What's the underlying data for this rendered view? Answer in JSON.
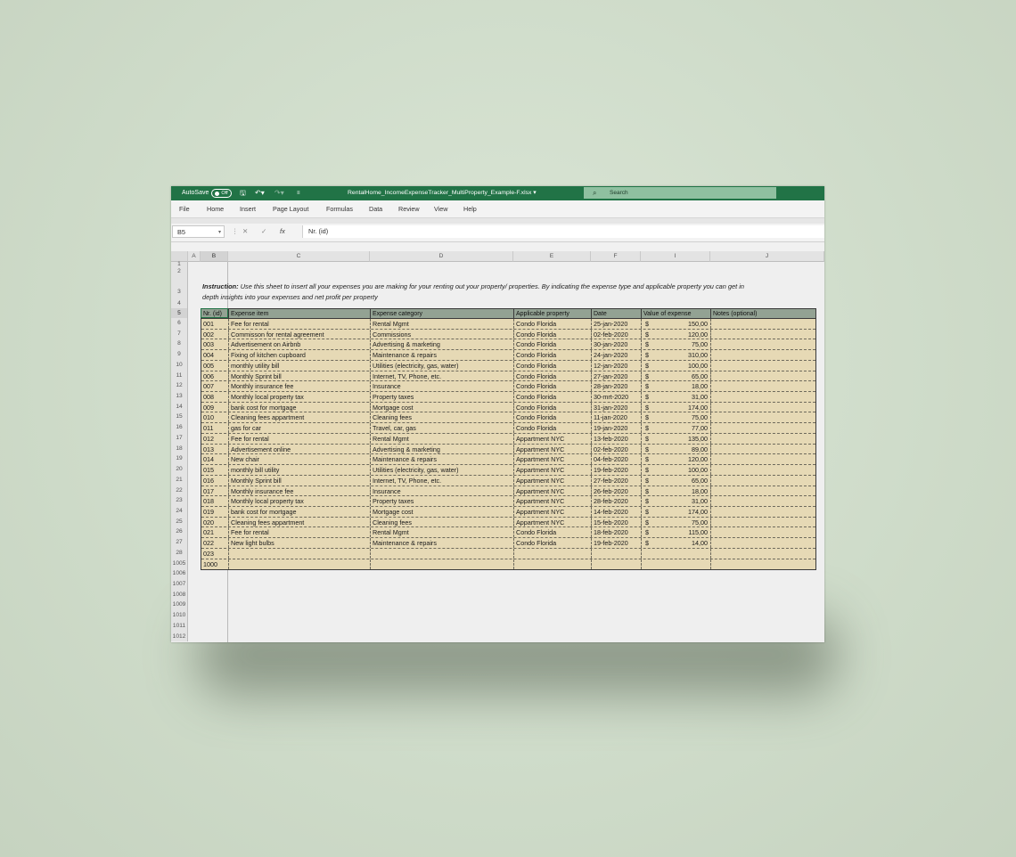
{
  "titlebar": {
    "autosave_label": "AutoSave",
    "autosave_state": "Off",
    "filename": "RentalHome_IncomeExpenseTracker_MultiProperty_Example-F.xlsx",
    "search_placeholder": "Search"
  },
  "menu": [
    "File",
    "Home",
    "Insert",
    "Page Layout",
    "Formulas",
    "Data",
    "Review",
    "View",
    "Help"
  ],
  "formula_bar": {
    "name_box": "B5",
    "fx": "fx",
    "content": "Nr. (id)"
  },
  "columns": [
    "A",
    "B",
    "C",
    "D",
    "E",
    "F",
    "I",
    "J"
  ],
  "row_numbers": [
    "1",
    "2",
    "3",
    "4",
    "5",
    "6",
    "7",
    "8",
    "9",
    "10",
    "11",
    "12",
    "13",
    "14",
    "15",
    "16",
    "17",
    "18",
    "19",
    "20",
    "21",
    "22",
    "23",
    "24",
    "25",
    "26",
    "27",
    "28",
    "1005",
    "1006",
    "1007",
    "1008",
    "1009",
    "1010",
    "1011",
    "1012"
  ],
  "instruction": {
    "label": "Instruction:",
    "line1": " Use this sheet to insert all your expenses you are making for your renting out your property/ properties. By indicating the expense type and applicable property you can get in",
    "line2": "depth insights into your expenses and net profit per property"
  },
  "table": {
    "headers": [
      "Nr. (id)",
      "Expense item",
      "Expense category",
      "Applicable property",
      "Date",
      "Value of expense",
      "Notes (optional)"
    ],
    "currency_symbol": "$",
    "rows": [
      {
        "id": "001",
        "item": "Fee for rental",
        "category": "Rental Mgmt",
        "property": "Condo Florida",
        "date": "25-jan-2020",
        "value": "150,00"
      },
      {
        "id": "002",
        "item": "Commisson for rental agreement",
        "category": "Commissions",
        "property": "Condo Florida",
        "date": "02-feb-2020",
        "value": "120,00"
      },
      {
        "id": "003",
        "item": "Advertisement on Airbnb",
        "category": "Advertising & marketing",
        "property": "Condo Florida",
        "date": "30-jan-2020",
        "value": "75,00"
      },
      {
        "id": "004",
        "item": "Fixing of kitchen cupboard",
        "category": "Maintenance & repairs",
        "property": "Condo Florida",
        "date": "24-jan-2020",
        "value": "310,00"
      },
      {
        "id": "005",
        "item": "monthly utility bill",
        "category": "Utilities (electricity, gas, water)",
        "property": "Condo Florida",
        "date": "12-jan-2020",
        "value": "100,00"
      },
      {
        "id": "006",
        "item": "Monthly Sprint bill",
        "category": "Internet, TV, Phone, etc.",
        "property": "Condo Florida",
        "date": "27-jan-2020",
        "value": "65,00"
      },
      {
        "id": "007",
        "item": "Monthly insurance fee",
        "category": "Insurance",
        "property": "Condo Florida",
        "date": "28-jan-2020",
        "value": "18,00"
      },
      {
        "id": "008",
        "item": "Monthly local property tax",
        "category": "Property taxes",
        "property": "Condo Florida",
        "date": "30-mrt-2020",
        "value": "31,00"
      },
      {
        "id": "009",
        "item": "bank cost for mortgage",
        "category": "Mortgage cost",
        "property": "Condo Florida",
        "date": "31-jan-2020",
        "value": "174,00"
      },
      {
        "id": "010",
        "item": "Cleaning fees appartment",
        "category": "Cleaning fees",
        "property": "Condo Florida",
        "date": "11-jan-2020",
        "value": "75,00"
      },
      {
        "id": "011",
        "item": "gas for car",
        "category": "Travel, car, gas",
        "property": "Condo Florida",
        "date": "19-jan-2020",
        "value": "77,00"
      },
      {
        "id": "012",
        "item": "Fee for rental",
        "category": "Rental Mgmt",
        "property": "Appartment NYC",
        "date": "13-feb-2020",
        "value": "135,00"
      },
      {
        "id": "013",
        "item": "Advertisement online",
        "category": "Advertising & marketing",
        "property": "Appartment NYC",
        "date": "02-feb-2020",
        "value": "89,00"
      },
      {
        "id": "014",
        "item": "New chair",
        "category": "Maintenance & repairs",
        "property": "Appartment NYC",
        "date": "04-feb-2020",
        "value": "120,00"
      },
      {
        "id": "015",
        "item": "monthly bill utility",
        "category": "Utilities (electricity, gas, water)",
        "property": "Appartment NYC",
        "date": "19-feb-2020",
        "value": "100,00"
      },
      {
        "id": "016",
        "item": "Monthly Sprint bill",
        "category": "Internet, TV, Phone, etc.",
        "property": "Appartment NYC",
        "date": "27-feb-2020",
        "value": "65,00"
      },
      {
        "id": "017",
        "item": "Monthly insurance fee",
        "category": "Insurance",
        "property": "Appartment NYC",
        "date": "26-feb-2020",
        "value": "18,00"
      },
      {
        "id": "018",
        "item": "Monthly local property tax",
        "category": "Property taxes",
        "property": "Appartment NYC",
        "date": "28-feb-2020",
        "value": "31,00"
      },
      {
        "id": "019",
        "item": "bank cost for mortgage",
        "category": "Mortgage cost",
        "property": "Appartment NYC",
        "date": "14-feb-2020",
        "value": "174,00"
      },
      {
        "id": "020",
        "item": "Cleaning fees appartment",
        "category": "Cleaning fees",
        "property": "Appartment NYC",
        "date": "15-feb-2020",
        "value": "75,00"
      },
      {
        "id": "021",
        "item": "Fee for rental",
        "category": "Rental Mgmt",
        "property": "Condo Florida",
        "date": "18-feb-2020",
        "value": "115,00"
      },
      {
        "id": "022",
        "item": "New light bulbs",
        "category": "Maintenance & repairs",
        "property": "Condo Florida",
        "date": "19-feb-2020",
        "value": "14,00"
      },
      {
        "id": "023",
        "item": "",
        "category": "",
        "property": "",
        "date": "",
        "value": ""
      },
      {
        "id": "1000",
        "item": "",
        "category": "",
        "property": "",
        "date": "",
        "value": ""
      }
    ]
  },
  "colors": {
    "excel_green": "#217346",
    "header_fill": "#93a293",
    "row_fill": "#e6d9b5"
  }
}
